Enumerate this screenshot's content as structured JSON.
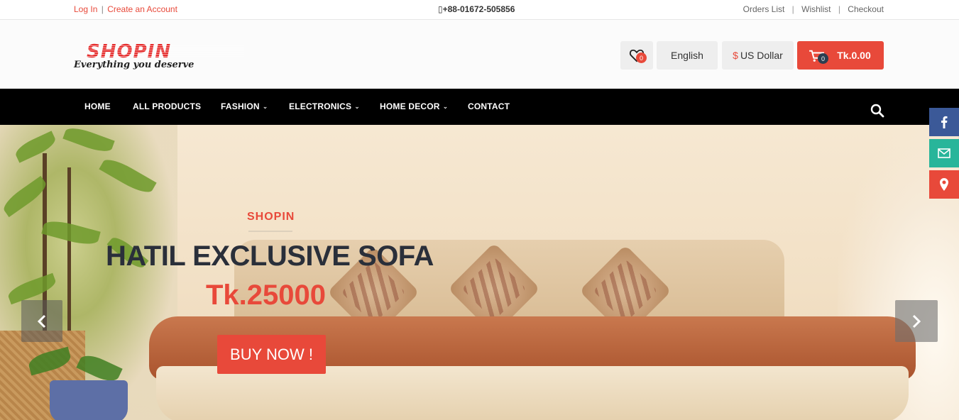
{
  "topbar": {
    "login": "Log In",
    "separator": "|",
    "create_account": "Create an Account",
    "phone": "+88-01672-505856",
    "orders": "Orders List",
    "wishlist": "Wishlist",
    "checkout": "Checkout",
    "divider": "|"
  },
  "header": {
    "logo_text": "SHOPIN",
    "tagline": "Everything you deserve",
    "wishlist_count": "0",
    "language": "English",
    "currency_symbol": "$",
    "currency": "US Dollar",
    "cart_count": "0",
    "cart_total": "Tk.0.00",
    "icons": {
      "wishlist": "heart-icon",
      "cart": "cart-icon"
    }
  },
  "nav": {
    "items": [
      {
        "label": "HOME",
        "dropdown": false
      },
      {
        "label": "ALL PRODUCTS",
        "dropdown": false
      },
      {
        "label": "FASHION",
        "dropdown": true
      },
      {
        "label": "ELECTRONICS",
        "dropdown": true
      },
      {
        "label": "HOME DECOR",
        "dropdown": true
      },
      {
        "label": "CONTACT",
        "dropdown": false
      }
    ],
    "search_icon": "search-icon"
  },
  "hero": {
    "subtitle": "SHOPIN",
    "title": "HATIL EXCLUSIVE SOFA",
    "price": "Tk.25000",
    "button": "BUY NOW !",
    "prev_icon": "chevron-left-icon",
    "next_icon": "chevron-right-icon"
  },
  "social": [
    {
      "name": "facebook-icon",
      "color": "#3b5998"
    },
    {
      "name": "mail-icon",
      "color": "#28b59a"
    },
    {
      "name": "map-pin-icon",
      "color": "#e8493a"
    }
  ],
  "colors": {
    "accent": "#e8493a",
    "nav": "#000000",
    "dark_text": "#2a2f3a"
  }
}
